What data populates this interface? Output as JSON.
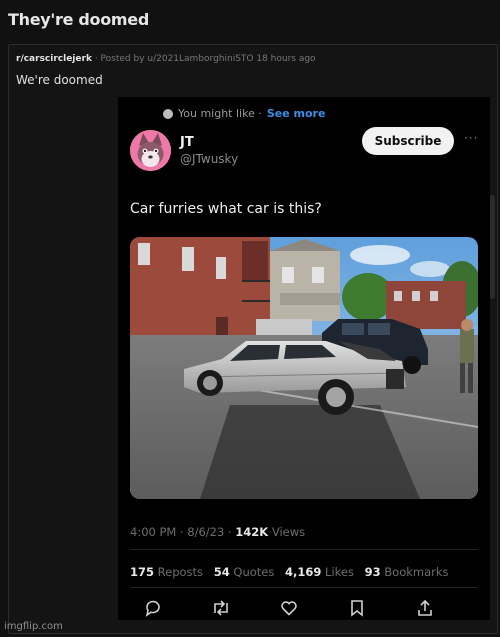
{
  "page_title": "They're doomed",
  "post": {
    "subreddit": "r/carscirclejerk",
    "posted_by": "· Posted by u/2021LamborghiniSTO 18 hours ago",
    "text": "We're doomed"
  },
  "tweet": {
    "suggestion_text": "You might like ·",
    "see_more": "See more",
    "author_name": "JT",
    "author_handle": "@JTwusky",
    "subscribe_label": "Subscribe",
    "body": "Car furries what car is this?",
    "time": "4:00 PM · 8/6/23 ·",
    "views_count": "142K",
    "views_label": "Views",
    "stats": {
      "reposts_count": "175",
      "reposts_label": "Reposts",
      "quotes_count": "54",
      "quotes_label": "Quotes",
      "likes_count": "4,169",
      "likes_label": "Likes",
      "bookmarks_count": "93",
      "bookmarks_label": "Bookmarks"
    }
  },
  "actions": [
    "reply-icon",
    "repost-icon",
    "like-icon",
    "bookmark-icon",
    "share-icon"
  ],
  "watermark": "imgflip.com",
  "colors": {
    "link_blue": "#3d8ee8",
    "background": "#111112",
    "tweet_background": "#000000"
  }
}
